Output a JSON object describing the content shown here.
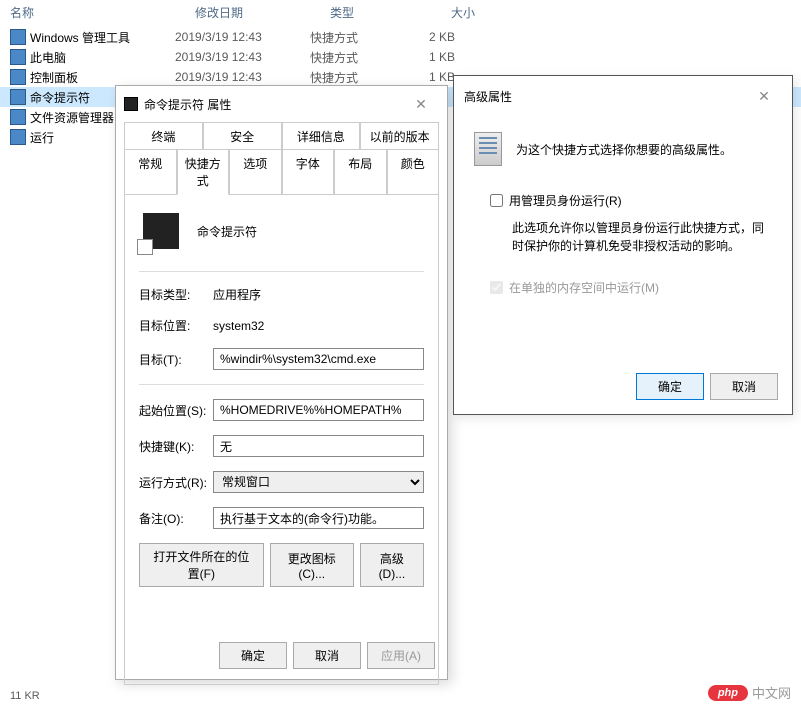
{
  "explorer": {
    "headers": {
      "name": "名称",
      "date": "修改日期",
      "type": "类型",
      "size": "大小"
    },
    "rows": [
      {
        "name": "Windows 管理工具",
        "date": "2019/3/19 12:43",
        "type": "快捷方式",
        "size": "2 KB",
        "selected": false
      },
      {
        "name": "此电脑",
        "date": "2019/3/19 12:43",
        "type": "快捷方式",
        "size": "1 KB",
        "selected": false
      },
      {
        "name": "控制面板",
        "date": "2019/3/19 12:43",
        "type": "快捷方式",
        "size": "1 KB",
        "selected": false
      },
      {
        "name": "命令提示符",
        "date": "",
        "type": "",
        "size": "",
        "selected": true
      },
      {
        "name": "文件资源管理器",
        "date": "",
        "type": "",
        "size": "",
        "selected": false
      },
      {
        "name": "运行",
        "date": "",
        "type": "",
        "size": "",
        "selected": false
      }
    ],
    "footer": "11 KR"
  },
  "props": {
    "title": "命令提示符 属性",
    "tabs_row1": [
      "终端",
      "安全",
      "详细信息",
      "以前的版本"
    ],
    "tabs_row2": [
      "常规",
      "快捷方式",
      "选项",
      "字体",
      "布局",
      "颜色"
    ],
    "active_tab": "快捷方式",
    "app_name": "命令提示符",
    "fields": {
      "target_type_label": "目标类型:",
      "target_type_value": "应用程序",
      "target_loc_label": "目标位置:",
      "target_loc_value": "system32",
      "target_label": "目标(T):",
      "target_value": "%windir%\\system32\\cmd.exe",
      "startin_label": "起始位置(S):",
      "startin_value": "%HOMEDRIVE%%HOMEPATH%",
      "shortcut_label": "快捷键(K):",
      "shortcut_value": "无",
      "run_label": "运行方式(R):",
      "run_value": "常规窗口",
      "comment_label": "备注(O):",
      "comment_value": "执行基于文本的(命令行)功能。"
    },
    "btns": {
      "open_loc": "打开文件所在的位置(F)",
      "change_icon": "更改图标(C)...",
      "advanced": "高级(D)..."
    },
    "bottom": {
      "ok": "确定",
      "cancel": "取消",
      "apply": "应用(A)"
    }
  },
  "adv": {
    "title": "高级属性",
    "heading": "为这个快捷方式选择你想要的高级属性。",
    "runas_label": "用管理员身份运行(R)",
    "runas_desc": "此选项允许你以管理员身份运行此快捷方式，同时保护你的计算机免受非授权活动的影响。",
    "sepmem_label": "在单独的内存空间中运行(M)",
    "ok": "确定",
    "cancel": "取消"
  },
  "watermark": {
    "badge": "php",
    "text": "中文网"
  }
}
